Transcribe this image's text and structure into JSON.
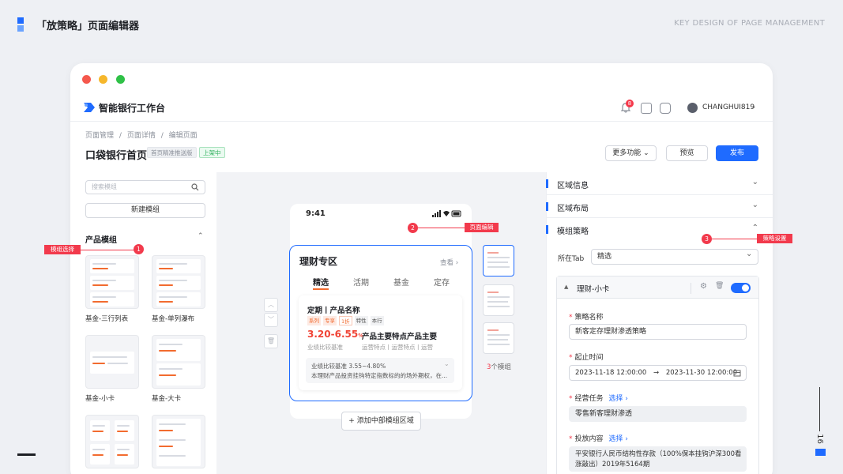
{
  "slide": {
    "title": "「放策略」页面编辑器",
    "subtitle_en": "KEY DESIGN OF PAGE MANAGEMENT",
    "page_number": "16"
  },
  "colors": {
    "primary": "#1f6bff",
    "annotation": "#f23a4c",
    "highlight": "#f26b2f"
  },
  "app": {
    "name": "智能银行工作台",
    "notification_count": "8",
    "username": "CHANGHUI819"
  },
  "breadcrumb": [
    "页面管理",
    "/",
    "页面详情",
    "/",
    "编辑页面"
  ],
  "page": {
    "title": "口袋银行首页",
    "tag_version": "首页精准推送版",
    "tag_status": "上架中",
    "btn_more": "更多功能",
    "btn_preview": "预览",
    "btn_publish": "发布"
  },
  "left": {
    "search_placeholder": "搜索模组",
    "new_module": "新建模组",
    "section_title": "产品模组",
    "thumbs": [
      {
        "label": "基金-三行列表"
      },
      {
        "label": "基金-单列瀑布"
      },
      {
        "label": "基金-小卡"
      },
      {
        "label": "基金-大卡"
      }
    ]
  },
  "annotations": {
    "a1": {
      "num": "1",
      "text": "模组选择"
    },
    "a2": {
      "num": "2",
      "text": "页面编辑"
    },
    "a3": {
      "num": "3",
      "text": "策略设置"
    }
  },
  "phone": {
    "time": "9:41",
    "section_title": "理财专区",
    "view_more": "查看",
    "tabs": [
      "精选",
      "活期",
      "基金",
      "定存"
    ],
    "product": {
      "name": "定期丨产品名称",
      "badges": [
        "系列",
        "专享",
        "1折",
        "特性",
        "本行"
      ],
      "rate": "3.20-6.55",
      "rate_unit": "%",
      "rate_label": "业绩比较基准",
      "feature_title": "产品主要特点产品主要",
      "feature_sub": "运营特点丨运营特点丨运营",
      "detail_line1": "业绩比较基准 3.55~4.80%",
      "detail_line2": "本理财产品投资挂钩特定指数标的的场外期权，在..."
    },
    "add_module": "添加中部模组区域",
    "module_count": "3",
    "module_count_suffix": "个模组"
  },
  "right": {
    "rows": [
      "区域信息",
      "区域布局",
      "模组策略"
    ],
    "tab_label": "所在Tab",
    "tab_value": "精选",
    "card_title": "理财-小卡",
    "fields": {
      "strategy_name_label": "策略名称",
      "strategy_name": "新客定存理财渗透策略",
      "time_label": "起止时间",
      "time_start": "2023-11-18 12:00:00",
      "time_arrow": "→",
      "time_end": "2023-11-30 12:00:00",
      "task_label": "经营任务",
      "select_link": "选择 ›",
      "task_value": "零售新客理财渗透",
      "content_label": "投放内容",
      "content_value_1": "平安银行人民币结构性存款（100%保本挂钩沪深300看",
      "content_value_2": "涨敲出）2019年5164期"
    }
  }
}
